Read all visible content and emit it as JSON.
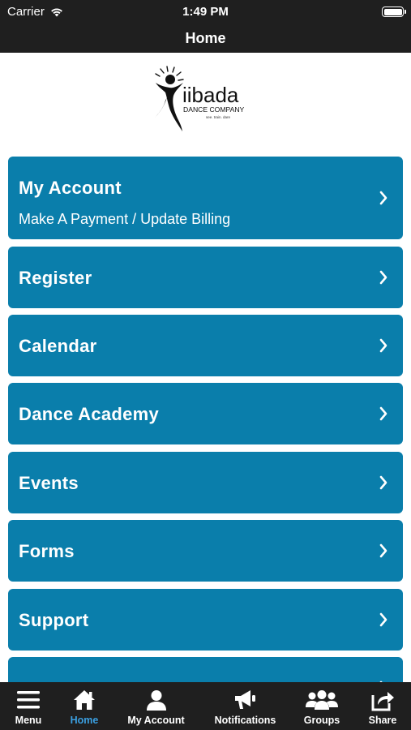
{
  "status_bar": {
    "carrier": "Carrier",
    "time": "1:49 PM"
  },
  "nav": {
    "title": "Home"
  },
  "logo": {
    "name": "iibada",
    "tagline": "DANCE COMPANY",
    "motto": "see. train. dare"
  },
  "menu": {
    "items": [
      {
        "title": "My Account",
        "subtitle": "Make A Payment / Update Billing"
      },
      {
        "title": "Register"
      },
      {
        "title": "Calendar"
      },
      {
        "title": "Dance Academy"
      },
      {
        "title": "Events"
      },
      {
        "title": "Forms"
      },
      {
        "title": "Support"
      }
    ]
  },
  "tabs": [
    {
      "label": "Menu",
      "icon": "menu-icon"
    },
    {
      "label": "Home",
      "icon": "home-icon",
      "active": true
    },
    {
      "label": "My Account",
      "icon": "user-icon"
    },
    {
      "label": "Notifications",
      "icon": "megaphone-icon"
    },
    {
      "label": "Groups",
      "icon": "groups-icon"
    },
    {
      "label": "Share",
      "icon": "share-icon"
    }
  ],
  "colors": {
    "accent": "#0a7eab",
    "bar_bg": "#1f1f1f",
    "active_tab": "#3b9fe0"
  }
}
